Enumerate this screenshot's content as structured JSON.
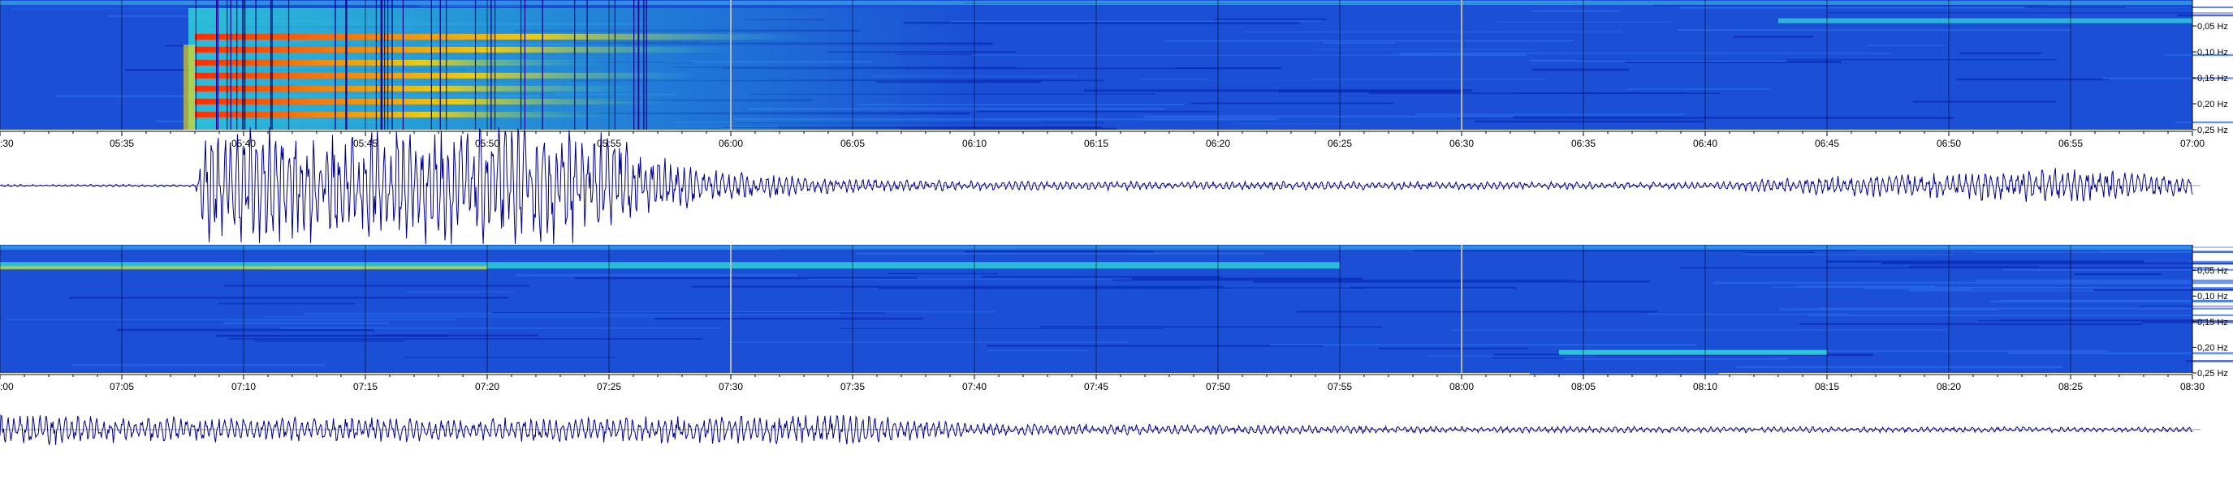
{
  "chart_data": [
    {
      "type": "heatmap",
      "panel": "upper",
      "x_start": "05:30",
      "x_end": "07:00",
      "x_ticks": [
        "05:35",
        "05:40",
        "05:45",
        "05:50",
        "05:55",
        "06:00",
        "06:05",
        "06:10",
        "06:15",
        "06:20",
        "06:25",
        "06:30",
        "06:35",
        "06:40",
        "06:45",
        "06:50",
        "06:55",
        "07:00"
      ],
      "x_ticks_partial": [
        "30"
      ],
      "y_ticks": [
        "0,05 Hz",
        "0,10 Hz",
        "0,15 Hz",
        "0,20 Hz",
        "0,25 Hz"
      ],
      "y_values_hz": [
        0.05,
        0.1,
        0.15,
        0.2,
        0.25
      ],
      "ylim_hz": [
        0.0,
        0.25
      ],
      "background_color": "#1a4fd6",
      "colors": {
        "low": "#0a2bb8",
        "mid": "#2fd0d8",
        "high": "#ffe000",
        "peak": "#c40000"
      },
      "event": {
        "onset": "05:38",
        "peak_end": "05:57",
        "decay_end": "06:10"
      },
      "white_marker_times": [
        "06:00",
        "06:30"
      ]
    },
    {
      "type": "line",
      "panel": "upper-trace",
      "x_start": "05:30",
      "x_end": "07:00",
      "line_color": "#00008b",
      "baseline_color": "#9a9a9a",
      "envelope": [
        {
          "t": "05:30",
          "a": 0.02
        },
        {
          "t": "05:38",
          "a": 0.02
        },
        {
          "t": "05:38.5",
          "a": 1.0
        },
        {
          "t": "05:55",
          "a": 1.0
        },
        {
          "t": "05:57",
          "a": 0.5
        },
        {
          "t": "06:00",
          "a": 0.25
        },
        {
          "t": "06:05",
          "a": 0.12
        },
        {
          "t": "06:10",
          "a": 0.08
        },
        {
          "t": "06:40",
          "a": 0.06
        },
        {
          "t": "06:47",
          "a": 0.2
        },
        {
          "t": "06:55",
          "a": 0.3
        },
        {
          "t": "07:00",
          "a": 0.15
        }
      ]
    },
    {
      "type": "heatmap",
      "panel": "lower",
      "x_start": "07:00",
      "x_end": "08:30",
      "x_ticks": [
        "07:05",
        "07:10",
        "07:15",
        "07:20",
        "07:25",
        "07:30",
        "07:35",
        "07:40",
        "07:45",
        "07:50",
        "07:55",
        "08:00",
        "08:05",
        "08:10",
        "08:15",
        "08:20",
        "08:25",
        "08:30"
      ],
      "x_ticks_partial": [
        "00"
      ],
      "y_ticks": [
        "0,05 Hz",
        "0,10 Hz",
        "0,15 Hz",
        "0,20 Hz",
        "0,25 Hz"
      ],
      "y_values_hz": [
        0.05,
        0.1,
        0.15,
        0.2,
        0.25
      ],
      "ylim_hz": [
        0.0,
        0.25
      ],
      "background_color": "#1a4fd6",
      "colors": {
        "low": "#0a2bb8",
        "mid": "#2fd0d8",
        "high": "#ffe000",
        "peak": "#c40000"
      },
      "white_marker_times": [
        "07:30",
        "08:00"
      ]
    },
    {
      "type": "line",
      "panel": "lower-trace",
      "x_start": "07:00",
      "x_end": "08:30",
      "line_color": "#00008b",
      "baseline_color": "#9a9a9a",
      "envelope": [
        {
          "t": "07:00",
          "a": 0.25
        },
        {
          "t": "07:05",
          "a": 0.2
        },
        {
          "t": "07:20",
          "a": 0.18
        },
        {
          "t": "07:30",
          "a": 0.22
        },
        {
          "t": "07:35",
          "a": 0.24
        },
        {
          "t": "07:40",
          "a": 0.1
        },
        {
          "t": "08:00",
          "a": 0.05
        },
        {
          "t": "08:30",
          "a": 0.04
        }
      ]
    }
  ]
}
